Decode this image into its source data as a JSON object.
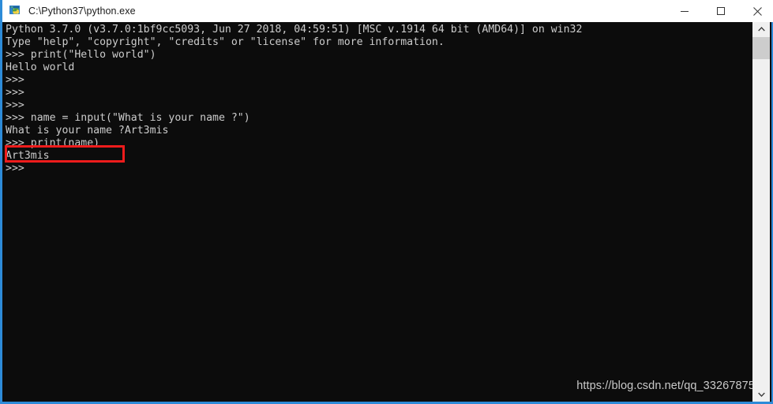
{
  "window": {
    "title": "C:\\Python37\\python.exe",
    "icon": "python-console-icon",
    "border_color": "#2d8bd8",
    "titlebar_bg": "#ffffff",
    "console_bg": "#0c0c0c",
    "console_fg": "#cccccc"
  },
  "titlebar_buttons": {
    "minimize": "minimize-icon",
    "maximize": "maximize-icon",
    "close": "close-icon"
  },
  "console": {
    "lines": [
      "Python 3.7.0 (v3.7.0:1bf9cc5093, Jun 27 2018, 04:59:51) [MSC v.1914 64 bit (AMD64)] on win32",
      "Type \"help\", \"copyright\", \"credits\" or \"license\" for more information.",
      ">>> print(\"Hello world\")",
      "Hello world",
      ">>>",
      ">>>",
      ">>>",
      ">>> name = input(\"What is your name ?\")",
      "What is your name ?Art3mis",
      ">>> print(name)",
      "Art3mis",
      ">>>"
    ]
  },
  "annotation": {
    "type": "red-rectangle-highlight",
    "color": "#ee1c1c",
    "targets_text": "What is your name ?"
  },
  "watermark": {
    "text": "https://blog.csdn.net/qq_33267875"
  },
  "scrollbar": {
    "up_arrow": "chevron-up-icon",
    "down_arrow": "chevron-down-icon",
    "thumb": "scrollbar-thumb"
  }
}
